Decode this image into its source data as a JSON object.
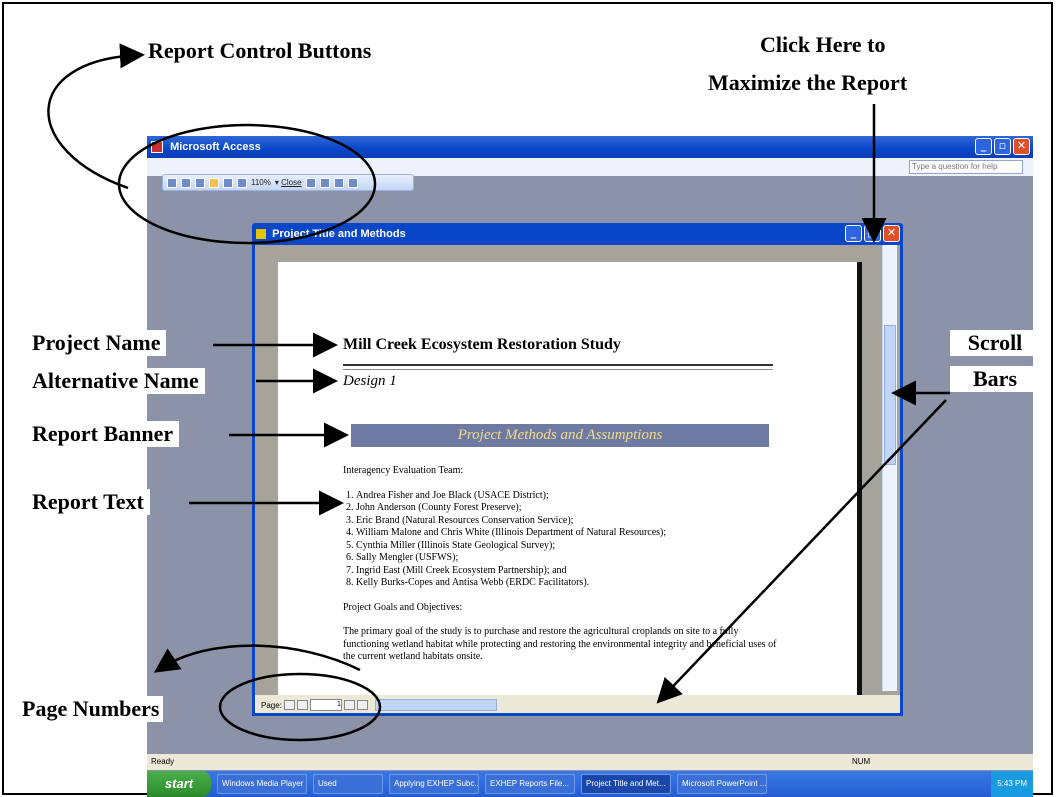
{
  "annotations": {
    "report_control_buttons": "Report Control Buttons",
    "maximize_line1": "Click Here to",
    "maximize_line2": "Maximize the Report",
    "project_name": "Project Name",
    "alternative_name": "Alternative Name",
    "report_banner": "Report Banner",
    "report_text": "Report Text",
    "scroll_line1": "Scroll",
    "scroll_line2": "Bars",
    "page_numbers": "Page Numbers"
  },
  "access_window": {
    "title": "Microsoft Access",
    "help_placeholder": "Type a question for help",
    "zoom": "110%",
    "close_label": "Close",
    "status": "Ready",
    "num": "NUM"
  },
  "report_window": {
    "title": "Project Title and Methods",
    "project_name": "Mill Creek Ecosystem Restoration Study",
    "alternative_name": "Design 1",
    "banner": "Project Methods and Assumptions",
    "team_heading": "Interagency Evaluation Team:",
    "team": [
      "Andrea Fisher and Joe Black (USACE District);",
      "John Anderson (County Forest Preserve);",
      "Eric Brand (Natural Resources Conservation Service);",
      "William Malone and Chris White (Illinois Department of Natural Resources);",
      "Cynthia Miller (Illinois State Geological Survey);",
      "Sally Mengler (USFWS);",
      "Ingrid East (Mill Creek Ecosystem Partnership); and",
      "Kelly Burks-Copes and Antisa Webb (ERDC Facilitators)."
    ],
    "goals_heading": "Project Goals and Objectives:",
    "goals_text": "The primary goal of the study is to purchase and restore the agricultural croplands on site to a fully functioning wetland habitat while protecting and restoring the environmental integrity and beneficial uses of the current wetland habitats onsite.",
    "page_label": "Page:",
    "page_number": "1"
  },
  "taskbar": {
    "start": "start",
    "items": [
      "Windows Media Player",
      "Used",
      "Applying EXHEP Subc...",
      "EXHEP Reports File...",
      "Project Title and Met...",
      "Microsoft PowerPoint ..."
    ],
    "clock": "5:43 PM"
  }
}
